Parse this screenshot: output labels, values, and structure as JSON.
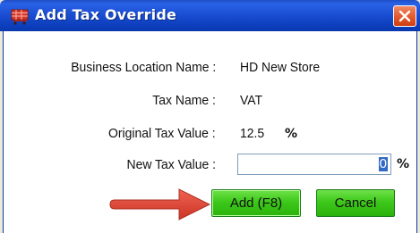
{
  "dialog": {
    "title": "Add Tax Override",
    "icon": "shopping-cart-icon",
    "close_icon": "close-icon",
    "accent_color": "#2a62e6"
  },
  "fields": {
    "business_location": {
      "label": "Business Location Name :",
      "value": "HD New Store"
    },
    "tax_name": {
      "label": "Tax Name :",
      "value": "VAT"
    },
    "original_tax_value": {
      "label": "Original Tax Value :",
      "value": "12.5",
      "unit": "%"
    },
    "new_tax_value": {
      "label": "New Tax Value :",
      "value": "0",
      "unit": "%"
    }
  },
  "buttons": {
    "add_label": "Add (F8)",
    "cancel_label": "Cancel",
    "button_color": "#3ec81a"
  },
  "annotation": {
    "arrow_color": "#e03e2d"
  }
}
